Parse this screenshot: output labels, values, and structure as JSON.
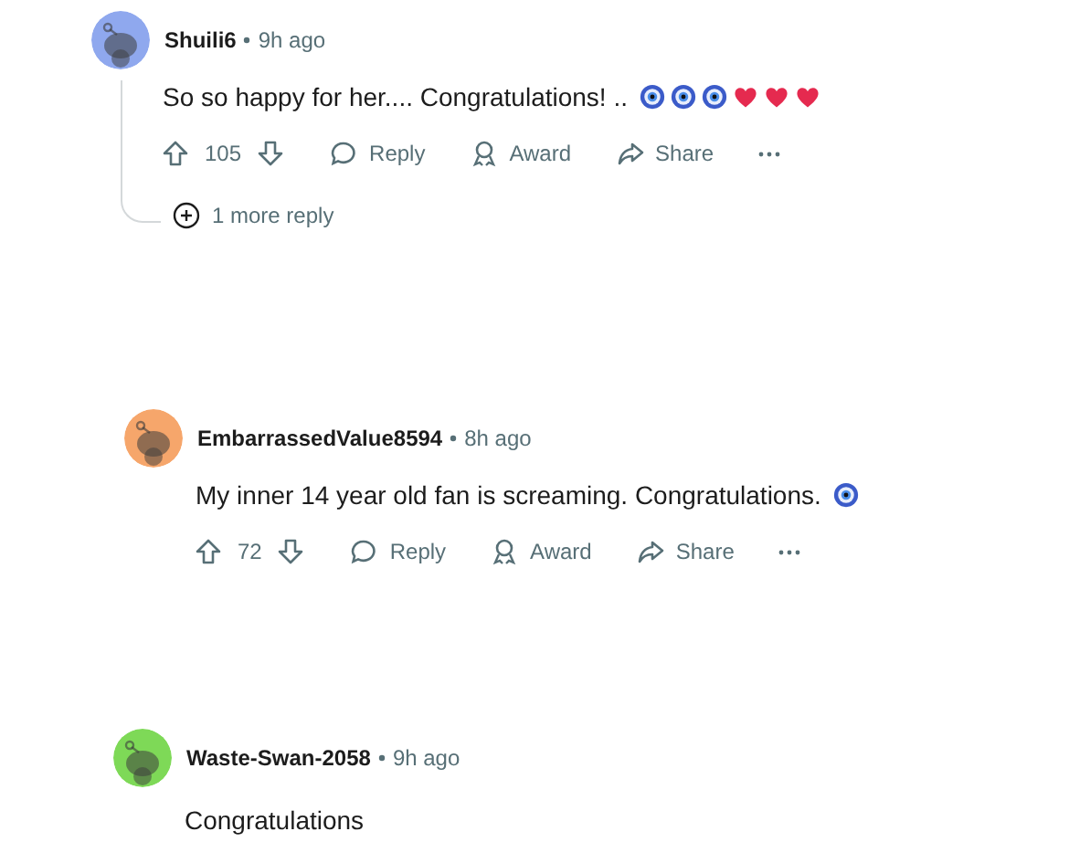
{
  "comments": [
    {
      "author": "Shuili6",
      "time": "9h ago",
      "color": "#8fa8ee",
      "body": "So so happy for her.... Congratulations! ..",
      "emojis": [
        {
          "kind": "nazar"
        },
        {
          "kind": "nazar"
        },
        {
          "kind": "nazar"
        },
        {
          "kind": "heart"
        },
        {
          "kind": "heart"
        },
        {
          "kind": "heart"
        }
      ],
      "votes": "105",
      "actions": [
        "Reply",
        "Award",
        "Share"
      ],
      "more_replies": "1 more reply"
    },
    {
      "author": "EmbarrassedValue8594",
      "time": "8h ago",
      "color": "#f6a66b",
      "body": "My inner 14 year old fan is screaming. Congratulations.",
      "emojis": [
        {
          "kind": "nazar"
        }
      ],
      "votes": "72",
      "actions": [
        "Reply",
        "Award",
        "Share"
      ]
    },
    {
      "author": "Waste-Swan-2058",
      "time": "9h ago",
      "color": "#7ed957",
      "body": "Congratulations"
    }
  ]
}
